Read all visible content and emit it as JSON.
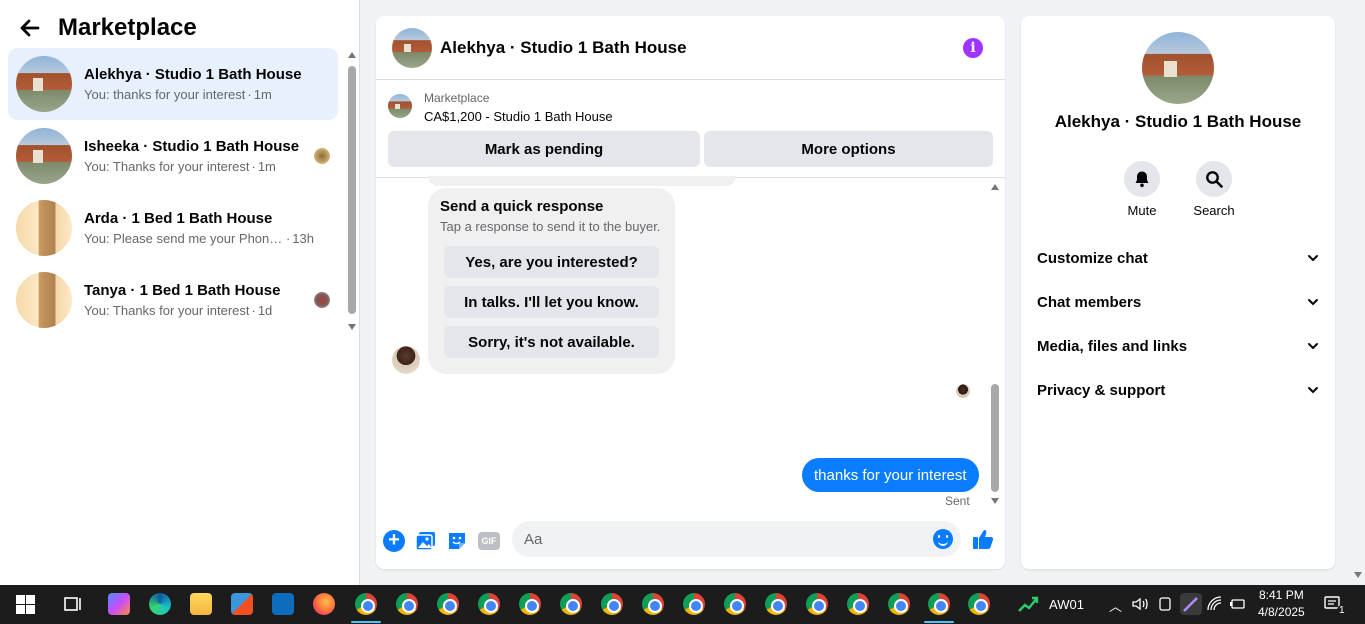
{
  "left_panel": {
    "title": "Marketplace",
    "conversations": [
      {
        "name": "Alekhya · Studio 1 Bath House",
        "snippet": "You: thanks for your interest",
        "time": "1m",
        "avatar": "house",
        "active": true
      },
      {
        "name": "Isheeka · Studio 1 Bath House",
        "snippet": "You: Thanks for your interest",
        "time": "1m",
        "avatar": "house",
        "active": false
      },
      {
        "name": "Arda · 1 Bed 1 Bath House",
        "snippet": "You: Please send me your Phone ...",
        "time": "13h",
        "avatar": "room",
        "active": false
      },
      {
        "name": "Tanya · 1 Bed 1 Bath House",
        "snippet": "You: Thanks for your interest",
        "time": "1d",
        "avatar": "room",
        "active": false
      }
    ]
  },
  "chat": {
    "title": "Alekhya · Studio 1 Bath House",
    "listing_source": "Marketplace",
    "listing_price": "CA$1,200 - Studio 1 Bath House",
    "mark_pending_label": "Mark as pending",
    "more_options_label": "More options",
    "quick_title": "Send a quick response",
    "quick_subtitle": "Tap a response to send it to the buyer.",
    "quick_replies": [
      "Yes, are you interested?",
      "In talks. I'll let you know.",
      "Sorry, it's not available."
    ],
    "my_message": "thanks for your interest",
    "sent_label": "Sent",
    "input_placeholder": "Aa",
    "gif_label": "GIF"
  },
  "right_panel": {
    "name": "Alekhya · Studio 1 Bath House",
    "actions": [
      {
        "label": "Mute",
        "icon": "bell-icon"
      },
      {
        "label": "Search",
        "icon": "search-icon"
      }
    ],
    "sections": [
      "Customize chat",
      "Chat members",
      "Media, files and links",
      "Privacy & support"
    ]
  },
  "taskbar": {
    "stock_label": "AW01",
    "time": "8:41 PM",
    "date": "4/8/2025",
    "notification_count": "1"
  },
  "colors": {
    "accent": "#0a7cff",
    "active_conv": "#e7f0fd",
    "info": "#a033ff",
    "taskbar": "#1c1c1c"
  }
}
